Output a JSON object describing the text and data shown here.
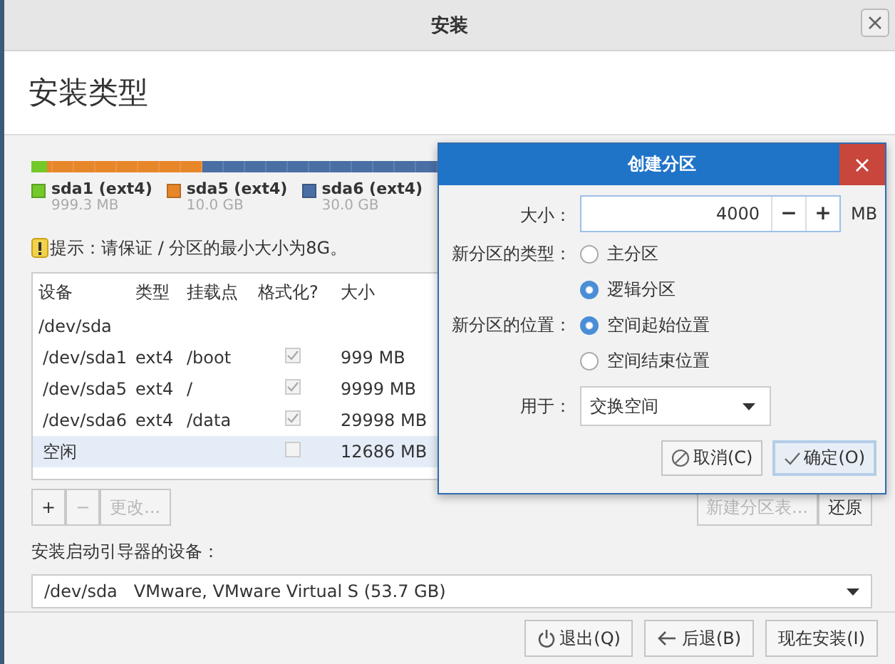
{
  "window": {
    "title": "安装"
  },
  "header": {
    "title": "安装类型"
  },
  "partition_bar": {
    "segments": [
      {
        "color": "#73c92a",
        "level": 0.019
      },
      {
        "color": "#e8862a",
        "level": 0.205
      },
      {
        "color": "#4a6fa5",
        "level": 0.764
      }
    ]
  },
  "legend": [
    {
      "label": "sda1 (ext4)",
      "size": "999.3 MB",
      "color": "#73c92a"
    },
    {
      "label": "sda5 (ext4)",
      "size": "10.0 GB",
      "color": "#e8862a"
    },
    {
      "label": "sda6 (ext4)",
      "size": "30.0 GB",
      "color": "#4a6fa5"
    }
  ],
  "hint": "提示：请保证 / 分区的最小大小为8G。",
  "table": {
    "columns": [
      "设备",
      "类型",
      "挂载点",
      "格式化?",
      "大小"
    ],
    "rows": [
      {
        "kind": "disk",
        "device": "/dev/sda",
        "selected": false
      },
      {
        "kind": "partition",
        "device": "/dev/sda1",
        "type": "ext4",
        "mount": "/boot",
        "format": true,
        "size": "999 MB",
        "selected": false
      },
      {
        "kind": "partition",
        "device": "/dev/sda5",
        "type": "ext4",
        "mount": "/",
        "format": true,
        "size": "9999 MB",
        "selected": false
      },
      {
        "kind": "partition",
        "device": "/dev/sda6",
        "type": "ext4",
        "mount": "/data",
        "format": true,
        "size": "29998 MB",
        "selected": false
      },
      {
        "kind": "free",
        "device": "空闲",
        "format": false,
        "size": "12686 MB",
        "selected": true
      }
    ]
  },
  "partition_buttons": [
    {
      "label": "+",
      "disabled": false
    },
    {
      "label": "−",
      "disabled": true
    },
    {
      "label": "更改...",
      "disabled": true
    }
  ],
  "table_buttons": [
    {
      "label": "新建分区表...",
      "disabled": true
    },
    {
      "label": "还原",
      "disabled": false
    }
  ],
  "bootloader": {
    "label": "安装启动引导器的设备：",
    "device": "/dev/sda",
    "description": "VMware, VMware Virtual S (53.7 GB)"
  },
  "footer_buttons": [
    {
      "kind": "quit",
      "label": "退出(Q)"
    },
    {
      "kind": "back",
      "label": "后退(B)"
    },
    {
      "kind": "install",
      "label": "现在安装(I)"
    }
  ],
  "dialog": {
    "title": "创建分区",
    "size_label": "大小：",
    "size_value": "4000",
    "decrement": "−",
    "increment": "+",
    "unit": "MB",
    "type_label": "新分区的类型：",
    "type_options": [
      {
        "label": "主分区",
        "selected": false
      },
      {
        "label": "逻辑分区",
        "selected": true
      }
    ],
    "location_label": "新分区的位置：",
    "location_options": [
      {
        "label": "空间起始位置",
        "selected": true
      },
      {
        "label": "空间结束位置",
        "selected": false
      }
    ],
    "use_label": "用于：",
    "use_value": "交换空间",
    "buttons": [
      {
        "kind": "cancel",
        "label": "取消(C)",
        "focused": false
      },
      {
        "kind": "ok",
        "label": "确定(O)",
        "focused": true
      }
    ]
  }
}
